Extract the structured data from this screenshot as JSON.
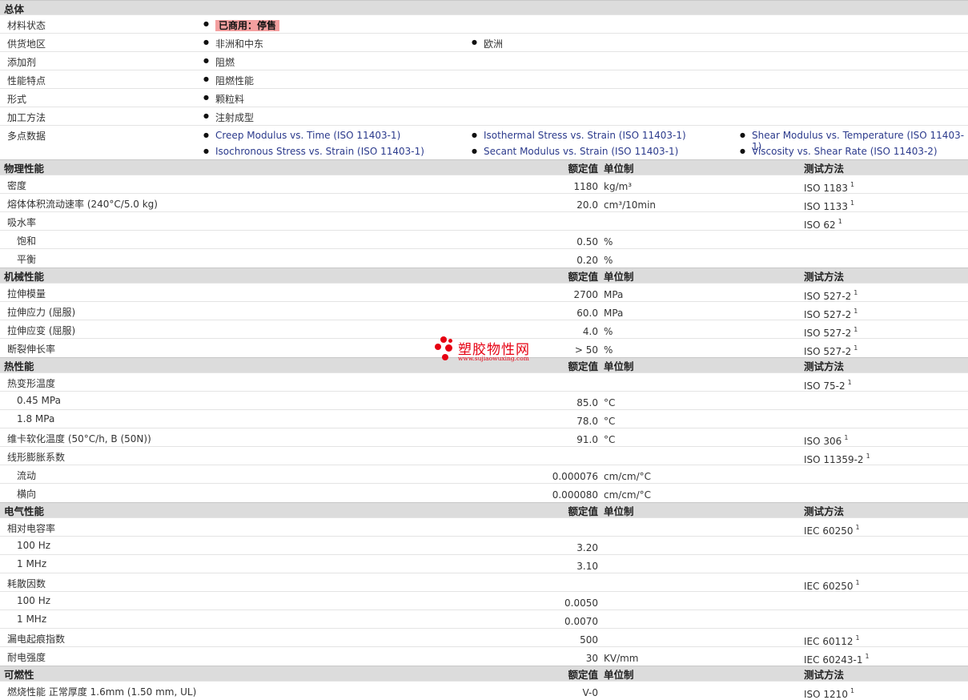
{
  "general": {
    "title": "总体",
    "material_status_label": "材料状态",
    "material_status": "已商用：停售",
    "supply_label": "供货地区",
    "supply": [
      "非洲和中东",
      "欧洲"
    ],
    "additive_label": "添加剂",
    "additive": "阻燃",
    "feature_label": "性能特点",
    "feature": "阻燃性能",
    "form_label": "形式",
    "form": "颗粒料",
    "processing_label": "加工方法",
    "processing": "注射成型",
    "multipoint_label": "多点数据",
    "multipoint": [
      "Creep Modulus vs. Time (ISO 11403-1)",
      "Isothermal Stress vs. Strain (ISO 11403-1)",
      "Shear Modulus vs. Temperature (ISO 11403-1)",
      "Isochronous Stress vs. Strain (ISO 11403-1)",
      "Secant Modulus vs. Strain (ISO 11403-1)",
      "Viscosity vs. Shear Rate (ISO 11403-2)"
    ]
  },
  "columns": {
    "value": "额定值",
    "unit": "单位制",
    "method": "测试方法"
  },
  "physical": {
    "title": "物理性能",
    "rows": [
      {
        "label": "密度",
        "value": "1180",
        "unit": "kg/m³",
        "method": "ISO 1183",
        "note": "1"
      },
      {
        "label": "熔体体积流动速率 (240°C/5.0 kg)",
        "value": "20.0",
        "unit": "cm³/10min",
        "method": "ISO 1133",
        "note": "1"
      },
      {
        "label": "吸水率",
        "value": "",
        "unit": "",
        "method": "ISO 62",
        "note": "1"
      },
      {
        "label": "饱和",
        "value": "0.50",
        "unit": "%",
        "method": "",
        "note": ""
      },
      {
        "label": "平衡",
        "value": "0.20",
        "unit": "%",
        "method": "",
        "note": ""
      }
    ]
  },
  "mechanical": {
    "title": "机械性能",
    "rows": [
      {
        "label": "拉伸模量",
        "value": "2700",
        "unit": "MPa",
        "method": "ISO 527-2",
        "note": "1"
      },
      {
        "label": "拉伸应力 (屈服)",
        "value": "60.0",
        "unit": "MPa",
        "method": "ISO 527-2",
        "note": "1"
      },
      {
        "label": "拉伸应变 (屈服)",
        "value": "4.0",
        "unit": "%",
        "method": "ISO 527-2",
        "note": "1"
      },
      {
        "label": "断裂伸长率",
        "value": "> 50",
        "unit": "%",
        "method": "ISO 527-2",
        "note": "1"
      }
    ]
  },
  "thermal": {
    "title": "热性能",
    "rows": [
      {
        "label": "热变形温度",
        "value": "",
        "unit": "",
        "method": "ISO 75-2",
        "note": "1"
      },
      {
        "label": "0.45 MPa",
        "value": "85.0",
        "unit": "°C",
        "method": "",
        "note": ""
      },
      {
        "label": "1.8 MPa",
        "value": "78.0",
        "unit": "°C",
        "method": "",
        "note": ""
      },
      {
        "label": "维卡软化温度 (50°C/h, B (50N))",
        "value": "91.0",
        "unit": "°C",
        "method": "ISO 306",
        "note": "1"
      },
      {
        "label": "线形膨胀系数",
        "value": "",
        "unit": "",
        "method": "ISO 11359-2",
        "note": "1"
      },
      {
        "label": "流动",
        "value": "0.000076",
        "unit": "cm/cm/°C",
        "method": "",
        "note": ""
      },
      {
        "label": "横向",
        "value": "0.000080",
        "unit": "cm/cm/°C",
        "method": "",
        "note": ""
      }
    ]
  },
  "electrical": {
    "title": "电气性能",
    "rows": [
      {
        "label": "相对电容率",
        "value": "",
        "unit": "",
        "method": "IEC 60250",
        "note": "1"
      },
      {
        "label": "100 Hz",
        "value": "3.20",
        "unit": "",
        "method": "",
        "note": ""
      },
      {
        "label": "1 MHz",
        "value": "3.10",
        "unit": "",
        "method": "",
        "note": ""
      },
      {
        "label": "耗散因数",
        "value": "",
        "unit": "",
        "method": "IEC 60250",
        "note": "1"
      },
      {
        "label": "100 Hz",
        "value": "0.0050",
        "unit": "",
        "method": "",
        "note": ""
      },
      {
        "label": "1 MHz",
        "value": "0.0070",
        "unit": "",
        "method": "",
        "note": ""
      },
      {
        "label": "漏电起痕指数",
        "value": "500",
        "unit": "",
        "method": "IEC 60112",
        "note": "1"
      },
      {
        "label": "耐电强度",
        "value": "30",
        "unit": "KV/mm",
        "method": "IEC 60243-1",
        "note": "1"
      }
    ]
  },
  "flammability": {
    "title": "可燃性",
    "rows": [
      {
        "label": "燃烧性能 正常厚度 1.6mm (1.50 mm, UL)",
        "value": "V-0",
        "unit": "",
        "method": "ISO 1210",
        "note": "1"
      }
    ]
  },
  "watermark": {
    "name": "塑胶物性网",
    "url": "www.sujiaowuxing.com"
  }
}
